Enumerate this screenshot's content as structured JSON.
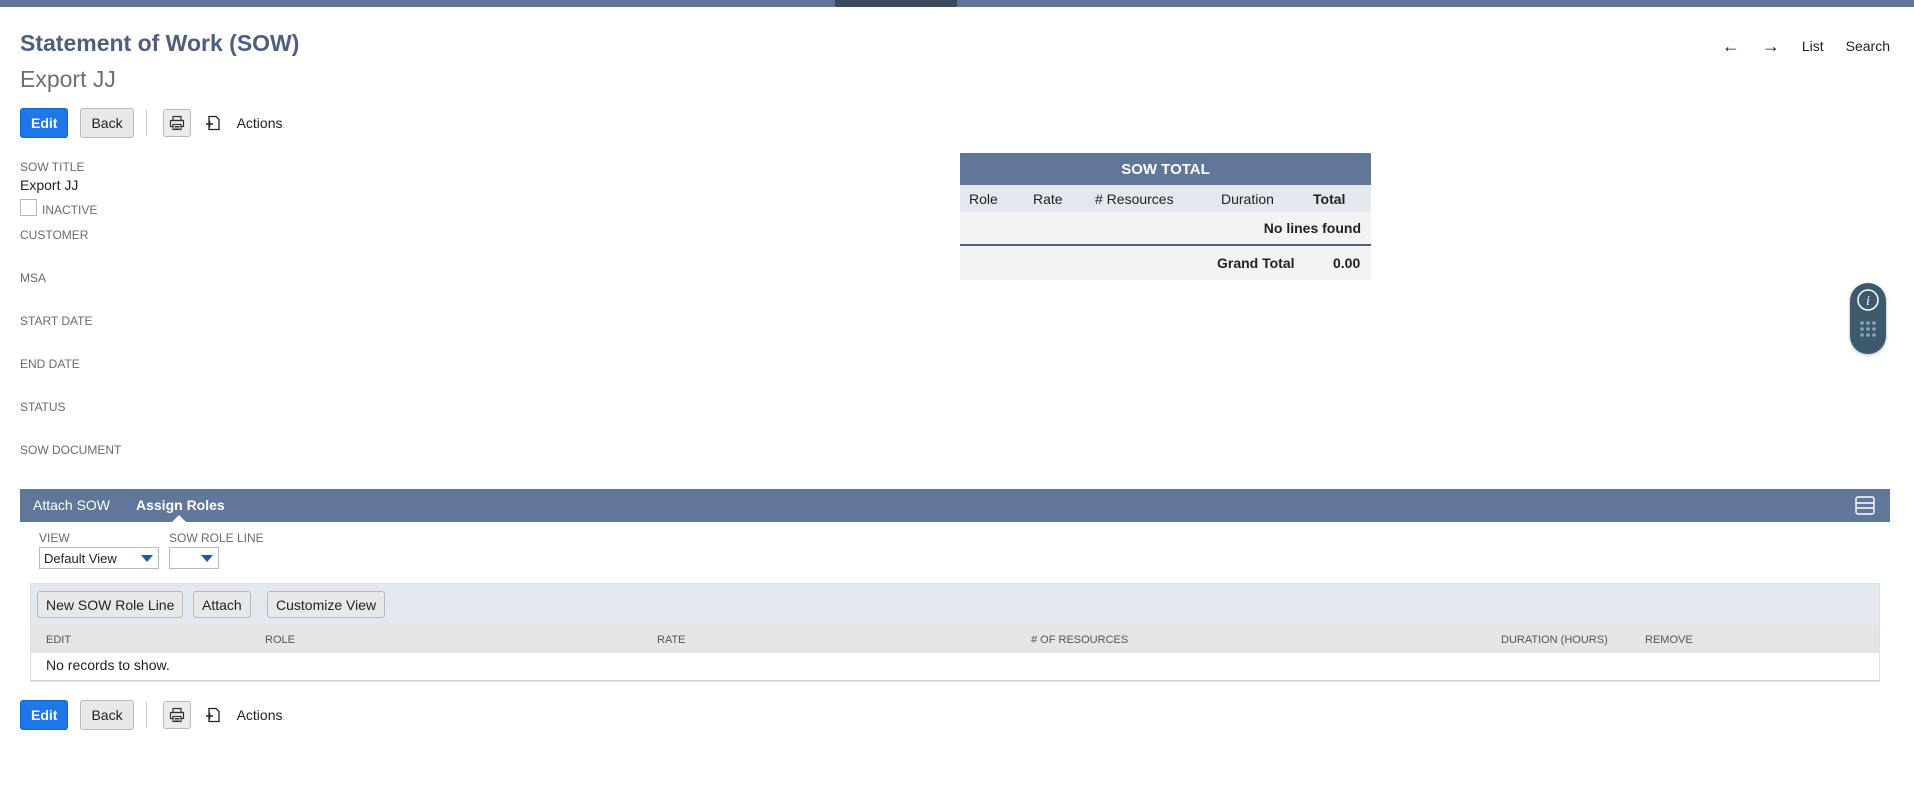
{
  "header": {
    "page_title": "Statement of Work (SOW)",
    "record_name": "Export JJ",
    "nav": {
      "prev_icon": "arrow-left-icon",
      "next_icon": "arrow-right-icon",
      "list_label": "List",
      "search_label": "Search"
    }
  },
  "toolbar": {
    "edit_label": "Edit",
    "back_label": "Back",
    "print_icon": "print-icon",
    "new_icon": "new-document-icon",
    "actions_label": "Actions"
  },
  "fields": {
    "sow_title_label": "SOW TITLE",
    "sow_title_value": "Export JJ",
    "inactive_label": "INACTIVE",
    "inactive_checked": false,
    "customer_label": "CUSTOMER",
    "msa_label": "MSA",
    "start_date_label": "START DATE",
    "end_date_label": "END DATE",
    "status_label": "STATUS",
    "sow_document_label": "SOW DOCUMENT"
  },
  "sow_total": {
    "title": "SOW TOTAL",
    "columns": [
      "Role",
      "Rate",
      "# Resources",
      "Duration",
      "Total"
    ],
    "empty_text": "No lines found",
    "grand_total_label": "Grand Total",
    "grand_total_value": "0.00"
  },
  "subtabs": {
    "tabs": [
      {
        "label": "Attach SOW",
        "active": false
      },
      {
        "label": "Assign Roles",
        "active": true
      }
    ]
  },
  "filters": {
    "view_label": "VIEW",
    "view_value": "Default View",
    "role_line_label": "SOW ROLE LINE",
    "role_line_value": ""
  },
  "sublist": {
    "buttons": [
      "New SOW Role Line",
      "Attach",
      "Customize View"
    ],
    "columns": [
      "EDIT",
      "ROLE",
      "RATE",
      "# OF RESOURCES",
      "DURATION (HOURS)",
      "REMOVE"
    ],
    "empty_text": "No records to show."
  },
  "colors": {
    "header_blue": "#607799",
    "title_blue": "#4d5f79",
    "primary_button": "#1f76e6",
    "widget": "#3d5a6d"
  }
}
